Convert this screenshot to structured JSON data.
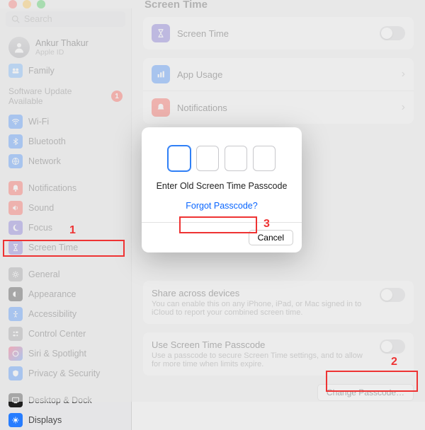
{
  "window": {
    "title": "Screen Time"
  },
  "traffic": {
    "red": "close",
    "yellow": "minimize",
    "green": "zoom"
  },
  "search": {
    "placeholder": "Search"
  },
  "profile": {
    "name": "Ankur Thakur",
    "sub": "Apple ID",
    "family": "Family"
  },
  "software_update": {
    "label": "Software Update Available",
    "count": "1"
  },
  "sidebar": {
    "g1": [
      {
        "label": "Wi-Fi",
        "icon": "wifi",
        "color": "#277dff"
      },
      {
        "label": "Bluetooth",
        "icon": "bluetooth",
        "color": "#277dff"
      },
      {
        "label": "Network",
        "icon": "network",
        "color": "#277dff"
      }
    ],
    "g2": [
      {
        "label": "Notifications",
        "icon": "bell",
        "color": "#ff453a"
      },
      {
        "label": "Sound",
        "icon": "sound",
        "color": "#ff453a"
      },
      {
        "label": "Focus",
        "icon": "focus",
        "color": "#6b5bd2"
      },
      {
        "label": "Screen Time",
        "icon": "hourglass",
        "color": "#6b5bd2"
      }
    ],
    "g3": [
      {
        "label": "General",
        "icon": "gear",
        "color": "#8e8e93"
      },
      {
        "label": "Appearance",
        "icon": "appearance",
        "color": "#1f1f1f"
      },
      {
        "label": "Accessibility",
        "icon": "accessibility",
        "color": "#277dff"
      },
      {
        "label": "Control Center",
        "icon": "controlcenter",
        "color": "#8e8e93"
      },
      {
        "label": "Siri & Spotlight",
        "icon": "siri",
        "color": "#1f1f1f"
      },
      {
        "label": "Privacy & Security",
        "icon": "privacy",
        "color": "#277dff"
      }
    ],
    "g4": [
      {
        "label": "Desktop & Dock",
        "icon": "desktop",
        "color": "#1f1f1f"
      },
      {
        "label": "Displays",
        "icon": "displays",
        "color": "#277dff"
      }
    ]
  },
  "main": {
    "screenTime": "Screen Time",
    "appUsage": "App Usage",
    "notifications": "Notifications",
    "shareTitle": "Share across devices",
    "shareDesc": "You can enable this on any iPhone, iPad, or Mac signed in to iCloud to report your combined screen time.",
    "passTitle": "Use Screen Time Passcode",
    "passDesc": "Use a passcode to secure Screen Time settings, and to allow for more time when limits expire.",
    "changeBtn": "Change Passcode…"
  },
  "modal": {
    "message": "Enter Old Screen Time Passcode",
    "forgot": "Forgot Passcode?",
    "cancel": "Cancel"
  },
  "anno": {
    "n1": "1",
    "n2": "2",
    "n3": "3"
  }
}
